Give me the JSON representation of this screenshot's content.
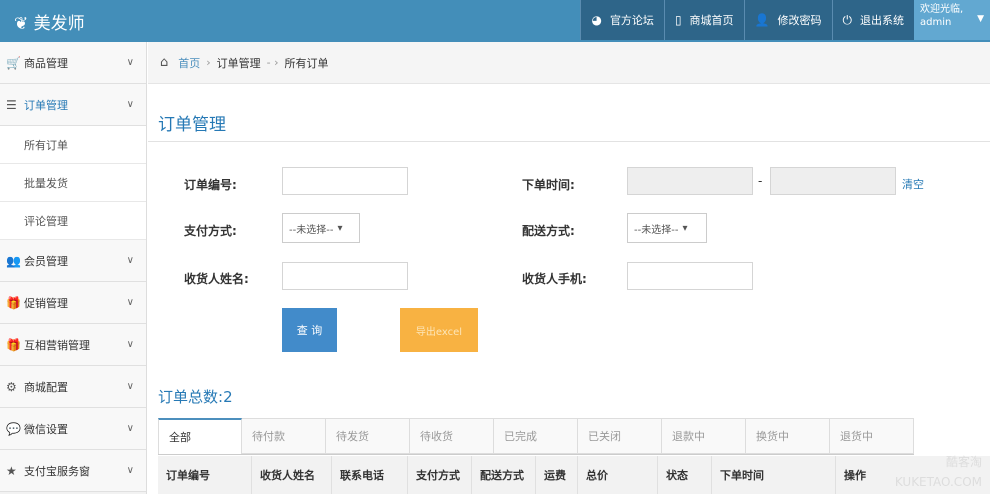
{
  "header": {
    "logo": "美发师",
    "nav": [
      {
        "icon": "globe-icon",
        "label": "官方论坛"
      },
      {
        "icon": "mobile-icon",
        "label": "商城首页"
      },
      {
        "icon": "user-icon",
        "label": "修改密码"
      },
      {
        "icon": "power-icon",
        "label": "退出系统"
      }
    ],
    "welcome": "欢迎光临,",
    "username": "admin"
  },
  "sidebar": {
    "items": [
      {
        "icon": "cart-icon",
        "label": "商品管理"
      },
      {
        "icon": "list-icon",
        "label": "订单管理",
        "sub": [
          "所有订单",
          "批量发货",
          "评论管理"
        ]
      },
      {
        "icon": "users-icon",
        "label": "会员管理"
      },
      {
        "icon": "gift-icon",
        "label": "促销管理"
      },
      {
        "icon": "gift-icon",
        "label": "互相营销管理"
      },
      {
        "icon": "cogs-icon",
        "label": "商城配置"
      },
      {
        "icon": "chat-icon",
        "label": "微信设置"
      },
      {
        "icon": "star-icon",
        "label": "支付宝服务窗"
      }
    ]
  },
  "breadcrumb": {
    "home": "首页",
    "level2": "订单管理",
    "level3": "所有订单"
  },
  "page": {
    "title": "订单管理"
  },
  "form": {
    "order_no": "订单编号:",
    "order_time": "下单时间:",
    "dash": "-",
    "clear": "清空",
    "payment": "支付方式:",
    "payment_value": "--未选择--",
    "delivery": "配送方式:",
    "delivery_value": "--未选择--",
    "receiver": "收货人姓名:",
    "phone": "收货人手机:",
    "search": "查 询",
    "export": "导出excel"
  },
  "orders": {
    "total_label": "订单总数:",
    "total": "2",
    "tabs": [
      "全部",
      "待付款",
      "待发货",
      "待收货",
      "已完成",
      "已关闭",
      "退款中",
      "换货中",
      "退货中"
    ],
    "columns": [
      "订单编号",
      "收货人姓名",
      "联系电话",
      "支付方式",
      "配送方式",
      "运费",
      "总价",
      "状态",
      "下单时间",
      "操作"
    ]
  },
  "watermark": {
    "line1": "酷客淘",
    "line2": "KUKETAO.COM"
  },
  "colors": {
    "topbar": "#438eb9",
    "primary": "#428bca",
    "warning": "#f8b242"
  }
}
